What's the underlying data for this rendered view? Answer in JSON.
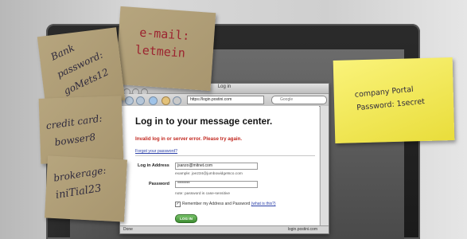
{
  "browser": {
    "window_title": "Log in",
    "url": "https://login.postini.com",
    "search_placeholder": "Google",
    "page_title": "Log in to your message center.",
    "error_message": "Invalid log in or server error. Please try again.",
    "forgot_link": "Forgot your password?",
    "login_address_label": "Log in Address",
    "login_address_value": "jsanzo@mitnet.com",
    "login_address_example": "example: joe234@jumbowidgetsco.com",
    "password_label": "Password",
    "password_value": "********",
    "password_note": "note: password is case-sensitive",
    "remember_label": "Remember my Address and Password",
    "remember_link": "(what is this?)",
    "login_button": "LOG IN",
    "status_left": "Done",
    "status_right": "login.postini.com"
  },
  "notes": {
    "email_line1": "e-mail:",
    "email_line2": "letmein",
    "bank_line1": "Bank",
    "bank_line2": "password:",
    "bank_line3": "goMets12",
    "credit_line1": "credit card:",
    "credit_line2": "bowser8",
    "brokerage_line1": "brokerage:",
    "brokerage_line2": "iniTial23",
    "portal_line1": "company Portal",
    "portal_line2": "Password: 1secret"
  },
  "colors": {
    "sticky_tan": "#b09f77",
    "sticky_yellow": "#f3e95a",
    "error_red": "#c2271f",
    "login_green": "#4a9a3c"
  }
}
